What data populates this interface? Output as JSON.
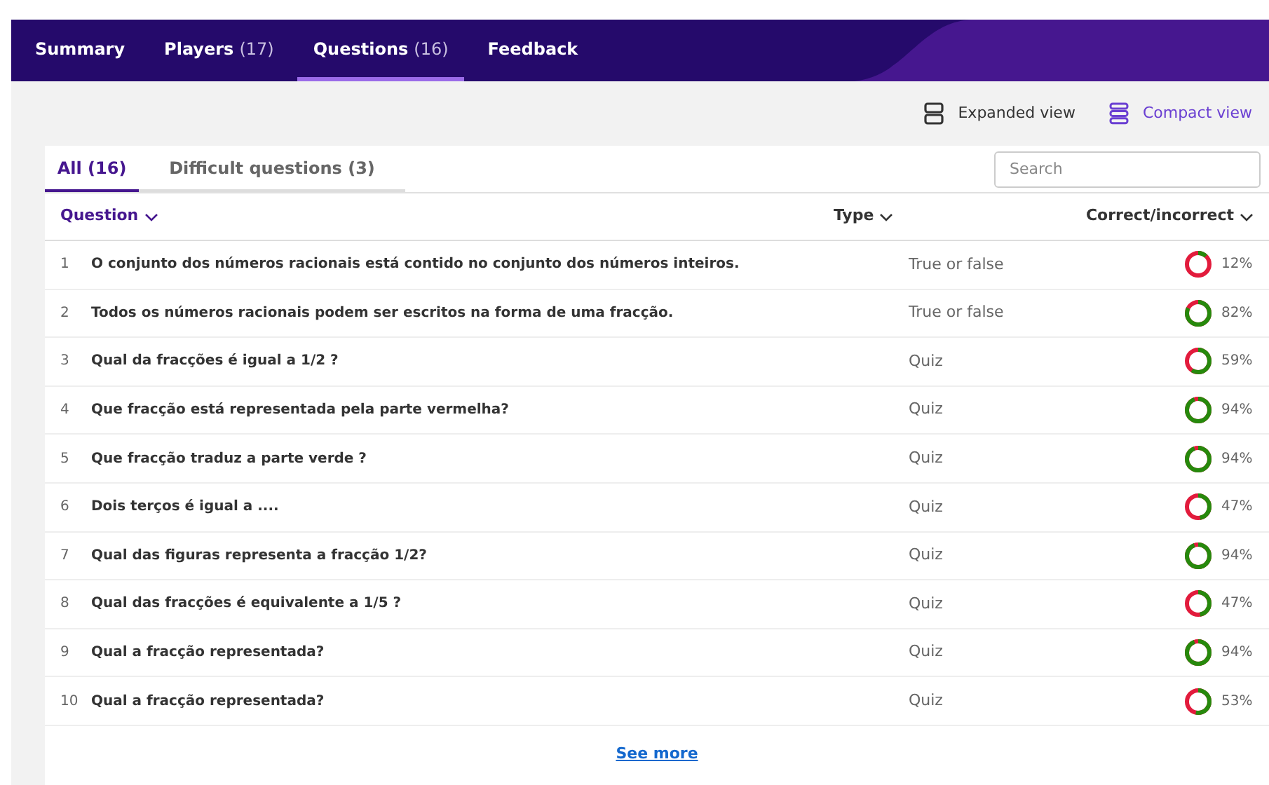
{
  "nav_tabs": [
    {
      "label": "Summary",
      "selected": false
    },
    {
      "label": "Players",
      "count": "(17)",
      "selected": false
    },
    {
      "label": "Questions",
      "count": "(16)",
      "selected": true
    },
    {
      "label": "Feedback",
      "selected": false
    }
  ],
  "view_toggle": [
    {
      "label": "Expanded view",
      "kind": "expanded",
      "selected": false
    },
    {
      "label": "Compact view",
      "kind": "compact",
      "selected": true
    }
  ],
  "filter_tabs": [
    {
      "label": "All (16)",
      "selected": true
    },
    {
      "label": "Difficult questions (3)",
      "selected": false
    }
  ],
  "search": {
    "placeholder": "Search"
  },
  "table": {
    "columns": [
      "Question",
      "Type",
      "Correct/incorrect"
    ],
    "rows": [
      {
        "number": "1",
        "question": "O conjunto dos números racionais está contido no conjunto dos números inteiros.",
        "type": "True or false",
        "percent": "12%"
      },
      {
        "number": "2",
        "question": "Todos os números racionais podem ser escritos na forma de uma fracção.",
        "type": "True or false",
        "percent": "82%"
      },
      {
        "number": "3",
        "question": "Qual da fracções é igual a 1/2 ?",
        "type": "Quiz",
        "percent": "59%"
      },
      {
        "number": "4",
        "question": "Que fracção está representada pela parte vermelha?",
        "type": "Quiz",
        "percent": "94%"
      },
      {
        "number": "5",
        "question": "Que fracção traduz a parte verde ?",
        "type": "Quiz",
        "percent": "94%"
      },
      {
        "number": "6",
        "question": "Dois terços é igual a ....",
        "type": "Quiz",
        "percent": "47%"
      },
      {
        "number": "7",
        "question": "Qual das figuras representa a fracção 1/2?",
        "type": "Quiz",
        "percent": "94%"
      },
      {
        "number": "8",
        "question": "Qual das fracções é equivalente a 1/5 ?",
        "type": "Quiz",
        "percent": "47%"
      },
      {
        "number": "9",
        "question": "Qual a fracção representada?",
        "type": "Quiz",
        "percent": "94%"
      },
      {
        "number": "10",
        "question": "Qual a fracção representada?",
        "type": "Quiz",
        "percent": "53%"
      }
    ]
  },
  "see_more": "See more"
}
